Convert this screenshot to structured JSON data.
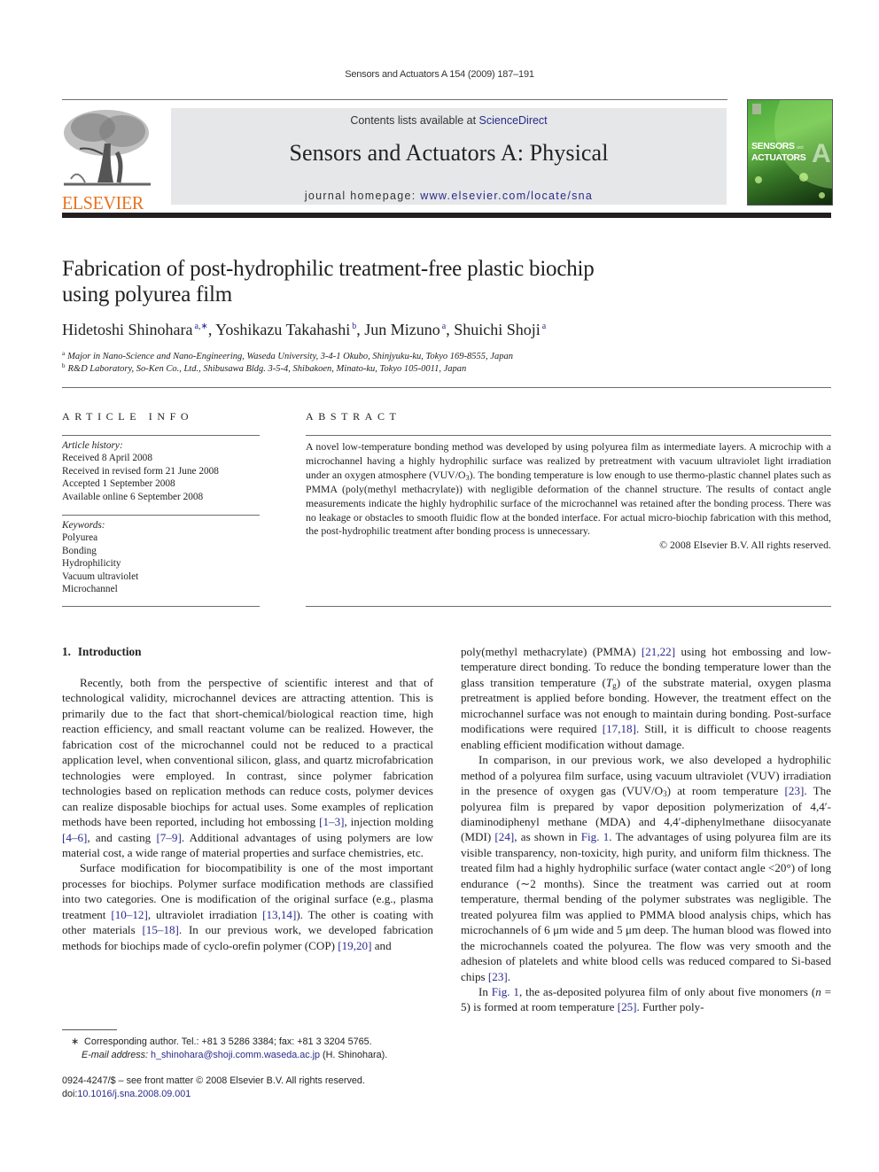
{
  "header": {
    "running_head": "Sensors and Actuators A 154 (2009) 187–191",
    "publisher_logo_text": "ELSEVIER",
    "contents_prefix": "Contents lists available at ",
    "contents_link": "ScienceDirect",
    "journal_title": "Sensors and Actuators A: Physical",
    "homepage_prefix": "journal homepage: ",
    "homepage_link": "www.elsevier.com/locate/sna",
    "cover": {
      "title_line1": "SENSORS",
      "title_small": "and",
      "title_line2": "ACTUATORS",
      "letter": "A",
      "accent_color": "#4aa83a"
    }
  },
  "article": {
    "title_line1": "Fabrication of post-hydrophilic treatment-free plastic biochip",
    "title_line2": "using polyurea film",
    "authors": [
      {
        "name": "Hidetoshi Shinohara",
        "sup": "a,∗",
        "sep": ", "
      },
      {
        "name": "Yoshikazu Takahashi",
        "sup": "b",
        "sep": ", "
      },
      {
        "name": "Jun Mizuno",
        "sup": "a",
        "sep": ", "
      },
      {
        "name": "Shuichi Shoji",
        "sup": "a",
        "sep": ""
      }
    ],
    "affiliations": [
      {
        "mark": "a",
        "text": "Major in Nano-Science and Nano-Engineering, Waseda University, 3-4-1 Okubo, Shinjyuku-ku, Tokyo 169-8555, Japan"
      },
      {
        "mark": "b",
        "text": "R&D Laboratory, So-Ken Co., Ltd., Shibusawa Bldg. 3-5-4, Shibakoen, Minato-ku, Tokyo 105-0011, Japan"
      }
    ]
  },
  "article_info": {
    "heading": "ARTICLE INFO",
    "history_label": "Article history:",
    "history": [
      "Received 8 April 2008",
      "Received in revised form 21 June 2008",
      "Accepted 1 September 2008",
      "Available online 6 September 2008"
    ],
    "keywords_label": "Keywords:",
    "keywords": [
      "Polyurea",
      "Bonding",
      "Hydrophilicity",
      "Vacuum ultraviolet",
      "Microchannel"
    ]
  },
  "abstract": {
    "heading": "ABSTRACT",
    "text_part1": "A novel low-temperature bonding method was developed by using polyurea film as intermediate layers. A microchip with a microchannel having a highly hydrophilic surface was realized by pretreatment with vacuum ultraviolet light irradiation under an oxygen atmosphere (VUV/O",
    "sub": "3",
    "text_part2": "). The bonding temperature is low enough to use thermo-plastic channel plates such as PMMA (poly(methyl methacrylate)) with negligible deformation of the channel structure. The results of contact angle measurements indicate the highly hydrophilic surface of the microchannel was retained after the bonding process. There was no leakage or obstacles to smooth fluidic flow at the bonded interface. For actual micro-biochip fabrication with this method, the post-hydrophilic treatment after bonding process is unnecessary.",
    "copyright": "© 2008 Elsevier B.V. All rights reserved."
  },
  "body": {
    "section_number": "1.",
    "section_title": "Introduction",
    "left": {
      "p1_a": "Recently, both from the perspective of scientific interest and that of technological validity, microchannel devices are attracting attention. This is primarily due to the fact that short-chemical/biological reaction time, high reaction efficiency, and small reactant volume can be realized. However, the fabrication cost of the microchannel could not be reduced to a practical application level, when conventional silicon, glass, and quartz microfabrication technologies were employed. In contrast, since polymer fabrication technologies based on replication methods can reduce costs, polymer devices can realize disposable biochips for actual uses. Some examples of replication methods have been reported, including hot embossing ",
      "ref1": "[1–3]",
      "p1_b": ", injection molding ",
      "ref2": "[4–6]",
      "p1_c": ", and casting ",
      "ref3": "[7–9]",
      "p1_d": ". Additional advantages of using polymers are low material cost, a wide range of material properties and surface chemistries, etc.",
      "p2_a": "Surface modification for biocompatibility is one of the most important processes for biochips. Polymer surface modification methods are classified into two categories. One is modification of the original surface (e.g., plasma treatment ",
      "ref4": "[10–12]",
      "p2_b": ", ultraviolet irradiation ",
      "ref5": "[13,14]",
      "p2_c": "). The other is coating with other materials ",
      "ref6": "[15–18]",
      "p2_d": ". In our previous work, we developed fabrication methods for biochips made of cyclo-orefin polymer (COP) ",
      "ref7": "[19,20]",
      "p2_e": " and"
    },
    "right": {
      "p1_a": "poly(methyl methacrylate) (PMMA) ",
      "ref1": "[21,22]",
      "p1_b": " using hot embossing and low-temperature direct bonding. To reduce the bonding temperature lower than the glass transition temperature (",
      "tg": "T",
      "tg_sub": "g",
      "p1_c": ") of the substrate material, oxygen plasma pretreatment is applied before bonding. However, the treatment effect on the microchannel surface was not enough to maintain during bonding. Post-surface modifications were required ",
      "ref2": "[17,18]",
      "p1_d": ". Still, it is difficult to choose reagents enabling efficient modification without damage.",
      "p2_a": "In comparison, in our previous work, we also developed a hydrophilic method of a polyurea film surface, using vacuum ultraviolet (VUV) irradiation in the presence of oxygen gas (VUV/O",
      "p2_sub": "3",
      "p2_b": ") at room temperature ",
      "ref3": "[23]",
      "p2_c": ". The polyurea film is prepared by vapor deposition polymerization of 4,4′-diaminodiphenyl methane (MDA) and 4,4′-diphenylmethane diisocyanate (MDI) ",
      "ref4": "[24]",
      "p2_d": ", as shown in ",
      "fig1": "Fig. 1",
      "p2_e": ". The advantages of using polyurea film are its visible transparency, non-toxicity, high purity, and uniform film thickness. The treated film had a highly hydrophilic surface (water contact angle <20°) of long endurance (∼2 months). Since the treatment was carried out at room temperature, thermal bending of the polymer substrates was negligible. The treated polyurea film was applied to PMMA blood analysis chips, which has microchannels of 6 μm wide and 5 μm deep. The human blood was flowed into the microchannels coated the polyurea. The flow was very smooth and the adhesion of platelets and white blood cells was reduced compared to Si-based chips ",
      "ref5": "[23]",
      "p2_f": ".",
      "p3_a": "In ",
      "fig1b": "Fig. 1",
      "p3_b": ", the as-deposited polyurea film of only about five monomers (",
      "n": "n",
      "p3_c": " = 5) is formed at room temperature ",
      "ref6": "[25]",
      "p3_d": ". Further poly-"
    }
  },
  "footnotes": {
    "star": "∗",
    "corresponding": "Corresponding author. Tel.: +81 3 5286 3384; fax: +81 3 3204 5765.",
    "email_label": "E-mail address: ",
    "email": "h_shinohara@shoji.comm.waseda.ac.jp",
    "email_suffix": " (H. Shinohara).",
    "issn_line": "0924-4247/$ – see front matter © 2008 Elsevier B.V. All rights reserved.",
    "doi_label": "doi:",
    "doi": "10.1016/j.sna.2008.09.001"
  }
}
